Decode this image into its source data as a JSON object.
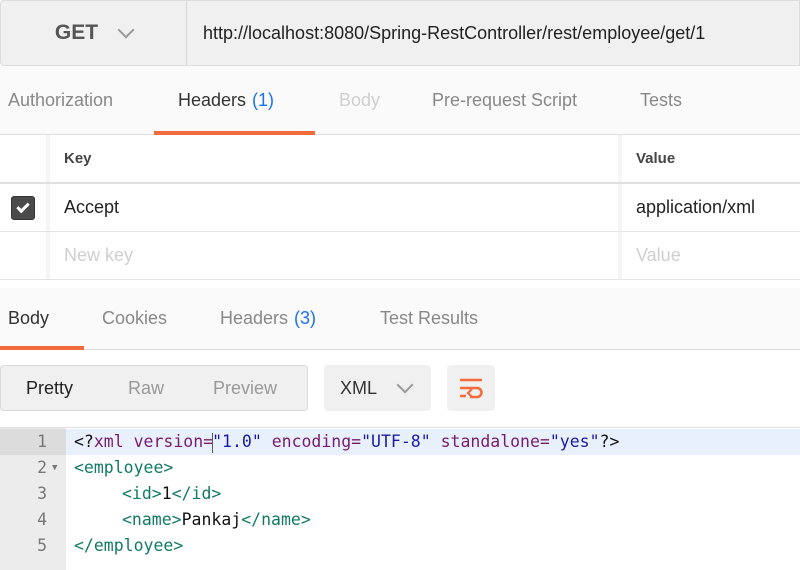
{
  "request": {
    "method": "GET",
    "url": "http://localhost:8080/Spring-RestController/rest/employee/get/1"
  },
  "request_tabs": [
    {
      "label": "Authorization",
      "count": null,
      "state": "normal"
    },
    {
      "label": "Headers",
      "count": "(1)",
      "state": "active"
    },
    {
      "label": "Body",
      "count": null,
      "state": "disabled"
    },
    {
      "label": "Pre-request Script",
      "count": null,
      "state": "normal"
    },
    {
      "label": "Tests",
      "count": null,
      "state": "normal"
    }
  ],
  "headers_table": {
    "columns": {
      "key": "Key",
      "value": "Value"
    },
    "rows": [
      {
        "checked": true,
        "key": "Accept",
        "value": "application/xml"
      }
    ],
    "new_row": {
      "key_placeholder": "New key",
      "value_placeholder": "Value"
    }
  },
  "response_tabs": [
    {
      "label": "Body",
      "count": null,
      "state": "active"
    },
    {
      "label": "Cookies",
      "count": null,
      "state": "normal"
    },
    {
      "label": "Headers",
      "count": "(3)",
      "state": "normal"
    },
    {
      "label": "Test Results",
      "count": null,
      "state": "normal"
    }
  ],
  "view_modes": {
    "pretty": "Pretty",
    "raw": "Raw",
    "preview": "Preview",
    "selected": "Pretty"
  },
  "format_select": {
    "value": "XML"
  },
  "wrap_button": {
    "icon": "wrap-lines-icon"
  },
  "code": {
    "line_numbers": [
      "1",
      "2",
      "3",
      "4",
      "5"
    ],
    "active_line": 1,
    "line1": {
      "open": "<?",
      "decl": "xml",
      "attr1": " version=",
      "val1": "\"1.0\"",
      "attr2": " encoding=",
      "val2": "\"UTF-8\"",
      "attr3": " standalone=",
      "val3": "\"yes\"",
      "close": "?>"
    },
    "line2": {
      "tag": "<employee>"
    },
    "line3": {
      "open": "<id>",
      "text": "1",
      "close": "</id>"
    },
    "line4": {
      "open": "<name>",
      "text": "Pankaj",
      "close": "</name>"
    },
    "line5": {
      "tag": "</employee>"
    }
  },
  "colors": {
    "accent": "#f26b3a",
    "count_blue": "#1a73e8",
    "xml_tag": "#117a65",
    "xml_attr": "#7a1a6e",
    "xml_string": "#1a1aa6"
  }
}
